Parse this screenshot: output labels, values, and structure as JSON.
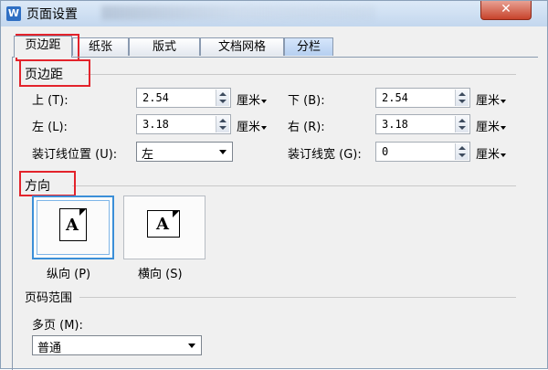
{
  "window": {
    "title": "页面设置",
    "app_icon": "W",
    "close_glyph": "✕"
  },
  "tabs": [
    {
      "label": "页边距",
      "active": true
    },
    {
      "label": "纸张"
    },
    {
      "label": "版式"
    },
    {
      "label": "文档网格"
    },
    {
      "label": "分栏"
    }
  ],
  "margins": {
    "group_label": "页边距",
    "top": {
      "label": "上 (T):",
      "value": "2.54",
      "unit": "厘米"
    },
    "bottom": {
      "label": "下 (B):",
      "value": "2.54",
      "unit": "厘米"
    },
    "left": {
      "label": "左 (L):",
      "value": "3.18",
      "unit": "厘米"
    },
    "right": {
      "label": "右 (R):",
      "value": "3.18",
      "unit": "厘米"
    },
    "gutter_position": {
      "label": "装订线位置 (U):",
      "value": "左"
    },
    "gutter_width": {
      "label": "装订线宽 (G):",
      "value": "0",
      "unit": "厘米"
    }
  },
  "orientation": {
    "group_label": "方向",
    "portrait": {
      "label": "纵向 (P)",
      "glyph": "A",
      "selected": true
    },
    "landscape": {
      "label": "横向 (S)",
      "glyph": "A",
      "selected": false
    }
  },
  "page_range": {
    "group_label": "页码范围",
    "multiple_pages": {
      "label": "多页 (M):",
      "value": "普通"
    }
  },
  "colors": {
    "highlight": "#e3232b",
    "selection": "#3b8fd8",
    "close": "#c7432b"
  }
}
